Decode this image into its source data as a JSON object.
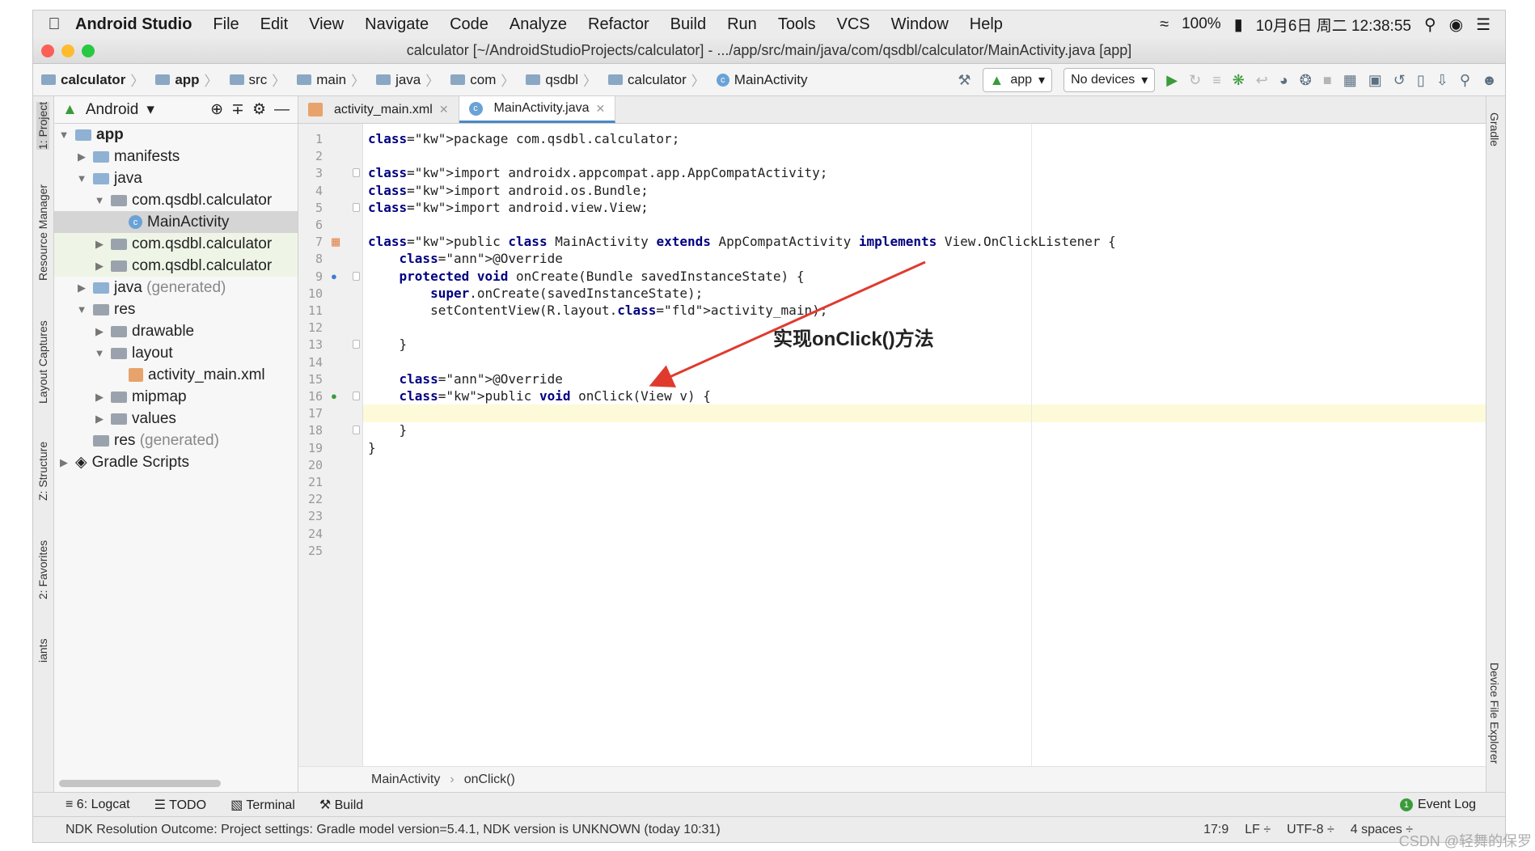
{
  "menubar": {
    "app_name": "Android Studio",
    "items": [
      "File",
      "Edit",
      "View",
      "Navigate",
      "Code",
      "Analyze",
      "Refactor",
      "Build",
      "Run",
      "Tools",
      "VCS",
      "Window",
      "Help"
    ],
    "battery": "100%",
    "datetime": "10月6日 周二 12:38:55"
  },
  "window": {
    "title": "calculator [~/AndroidStudioProjects/calculator] - .../app/src/main/java/com/qsdbl/calculator/MainActivity.java [app]"
  },
  "navbar": {
    "crumbs": [
      "calculator",
      "app",
      "src",
      "main",
      "java",
      "com",
      "qsdbl",
      "calculator",
      "MainActivity"
    ],
    "run_config": "app",
    "device": "No devices"
  },
  "left_tabs": [
    "1: Project",
    "Resource Manager",
    "Layout Captures",
    "Z: Structure",
    "2: Favorites",
    "iants"
  ],
  "right_tabs": [
    "Gradle",
    "Device File Explorer"
  ],
  "project_panel": {
    "view_mode": "Android",
    "tree": [
      {
        "label": "app",
        "suffix": ""
      },
      {
        "label": "manifests",
        "suffix": ""
      },
      {
        "label": "java",
        "suffix": ""
      },
      {
        "label": "com.qsdbl.calculator",
        "suffix": ""
      },
      {
        "label": "MainActivity",
        "suffix": ""
      },
      {
        "label": "com.qsdbl.calculator",
        "suffix": ""
      },
      {
        "label": "com.qsdbl.calculator",
        "suffix": ""
      },
      {
        "label": "java",
        "suffix": "(generated)"
      },
      {
        "label": "res",
        "suffix": ""
      },
      {
        "label": "drawable",
        "suffix": ""
      },
      {
        "label": "layout",
        "suffix": ""
      },
      {
        "label": "activity_main.xml",
        "suffix": ""
      },
      {
        "label": "mipmap",
        "suffix": ""
      },
      {
        "label": "values",
        "suffix": ""
      },
      {
        "label": "res",
        "suffix": "(generated)"
      },
      {
        "label": "Gradle Scripts",
        "suffix": ""
      }
    ]
  },
  "editor": {
    "tabs": [
      "activity_main.xml",
      "MainActivity.java"
    ],
    "line_numbers": [
      "1",
      "2",
      "3",
      "4",
      "5",
      "6",
      "7",
      "8",
      "9",
      "10",
      "11",
      "12",
      "13",
      "14",
      "15",
      "16",
      "17",
      "18",
      "19",
      "20",
      "21",
      "22",
      "23",
      "24",
      "25"
    ],
    "code": [
      "package com.qsdbl.calculator;",
      "",
      "import androidx.appcompat.app.AppCompatActivity;",
      "import android.os.Bundle;",
      "import android.view.View;",
      "",
      "public class MainActivity extends AppCompatActivity implements View.OnClickListener {",
      "    @Override",
      "    protected void onCreate(Bundle savedInstanceState) {",
      "        super.onCreate(savedInstanceState);",
      "        setContentView(R.layout.activity_main);",
      "",
      "    }",
      "",
      "    @Override",
      "    public void onClick(View v) {",
      "",
      "    }",
      "}"
    ],
    "breadcrumb": [
      "MainActivity",
      "onClick()"
    ],
    "annotation": "实现onClick()方法"
  },
  "bottom_tools": {
    "items": [
      "6: Logcat",
      "TODO",
      "Terminal",
      "Build"
    ],
    "event_log": "Event Log"
  },
  "statusbar": {
    "message": "NDK Resolution Outcome: Project settings: Gradle model version=5.4.1, NDK version is UNKNOWN (today 10:31)",
    "position": "17:9",
    "line_sep": "LF ÷",
    "encoding": "UTF-8 ÷",
    "indent": "4 spaces ÷"
  },
  "watermark": "CSDN @轻舞的保罗",
  "colors": {
    "arrow": "#e03a2f",
    "current_line": "#fcfad9",
    "keyword": "#000080",
    "annotation": "#808000"
  }
}
